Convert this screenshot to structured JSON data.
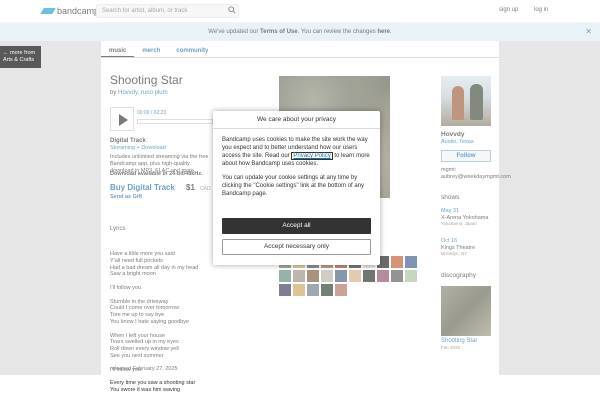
{
  "topbar": {
    "brand": "bandcamp",
    "search_placeholder": "Search for artist, album, or track",
    "signup": "sign up",
    "login": "log in"
  },
  "notice": {
    "pre": "We've updated our ",
    "terms": "Terms of Use",
    "mid": ". You can review the changes ",
    "here": "here",
    "post": "."
  },
  "more_from": {
    "line1": "← more from",
    "line2": "Arts & Crafts"
  },
  "tabs": [
    "music",
    "merch",
    "community"
  ],
  "album": {
    "title": "Shooting Star",
    "by_prefix": "by ",
    "artist": "Hovvdy, runo plum",
    "time": "00:00 / 02:23"
  },
  "purchase": {
    "digital_track": "Digital Track",
    "stream": "Streaming + Download",
    "includes": "Includes unlimited streaming via the free Bandcamp app, plus high-quality download in MP3, FLAC and more.",
    "dl24": "Download available in 24-bit/48kHz.",
    "buy": "Buy Digital Track",
    "price": "$1",
    "currency": "CAD",
    "gift": "Send as Gift"
  },
  "lyrics": {
    "heading": "Lyrics",
    "text": "Have a little more you said\nY'all need full pockets\nHad a bad dream all day in my head\nSaw a bright moon\n\nI'll follow you\n\nStumble in the driveway\nCould I come over tomorrow\nTore me up to say bye\nYou know I hate saying goodbye\n\nWhen I left your house\nTears swelled up in my eyes\nRoll down every window yell\nSee you next summer\n\nI'll follow you\n\nEvery time you saw a shooting star\nYou swore it was him waving"
  },
  "released": "released February 27, 2025",
  "band": {
    "name": "Hovvdy",
    "location": "Austin, Texas",
    "follow": "Follow",
    "mgmt": "mgmt:\naubrey@weekdaymgmt.com"
  },
  "shows_heading": "shows",
  "shows": [
    {
      "date": "May 31",
      "venue": "X-Arena Yokohama",
      "city": "Yokohama, Japan"
    },
    {
      "date": "Oct 16",
      "venue": "Kings Theatre",
      "city": "Brooklyn, NY"
    }
  ],
  "discography_heading": "discography",
  "discography": [
    {
      "title": "Shooting Star",
      "date": "Feb 2025"
    }
  ],
  "supporters": [
    "#6b7a5c",
    "#c7a66a",
    "#4c5466",
    "#8b6a4a",
    "#a8433a",
    "#2e2e2e",
    "#d9d2c2",
    "#1c1c1c",
    "#c05a2c",
    "#3b5b8a",
    "#5d8a7a",
    "#9a8f80",
    "#7a5a3a",
    "#b7b2a8",
    "#46627a",
    "#d4b08a",
    "#222d22",
    "#8e4f6a",
    "#5a5a5a",
    "#a6c0a0",
    "#3a3a5a",
    "#c9a55c",
    "#6a7a8a",
    "#2b3b2b",
    "#b07060"
  ],
  "consent": {
    "heading": "We care about your privacy",
    "p1_pre": "Bandcamp uses cookies to make the site work the way you expect and to better understand how our users access the site. Read our ",
    "privacy": "Privacy Policy",
    "p1_post": " to learn more about how Bandcamp uses cookies.",
    "p2": "You can update your cookie settings at any time by clicking the \"Cookie settings\" link at the bottom of any Bandcamp page.",
    "accept": "Accept all",
    "necessary": "Accept necessary only"
  }
}
